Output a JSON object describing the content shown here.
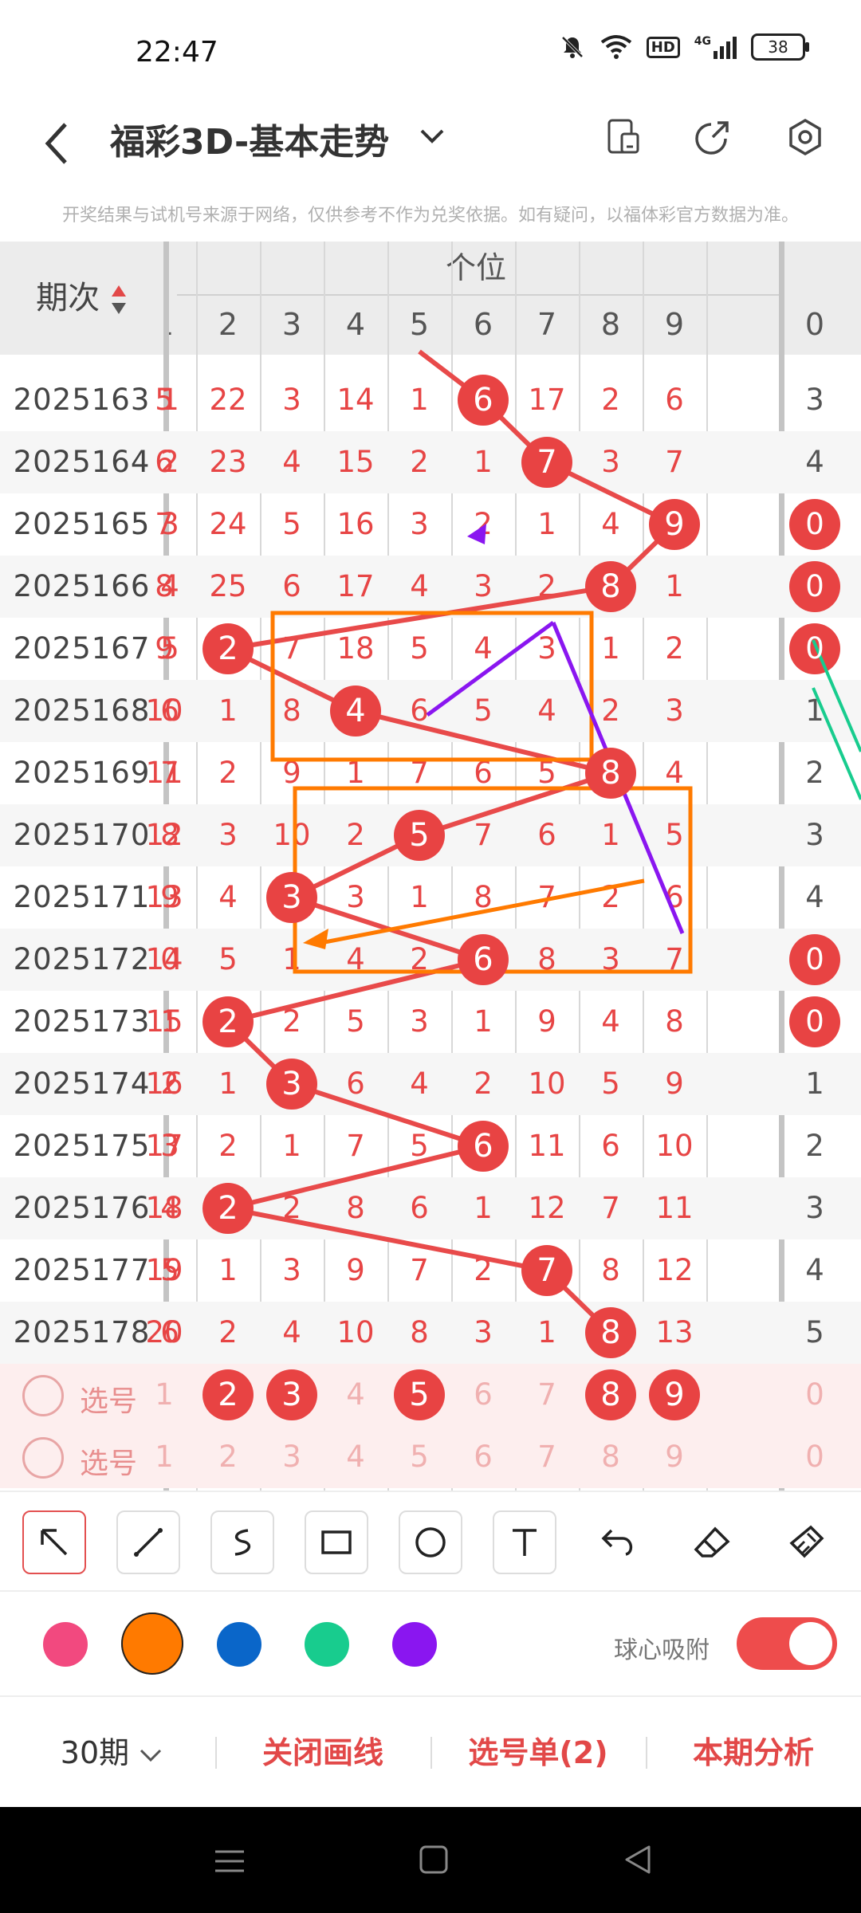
{
  "status": {
    "time": "22:47",
    "network": "4G",
    "hd": "HD",
    "battery": "38"
  },
  "title": {
    "text": "福彩3D-基本走势"
  },
  "notice": "开奖结果与试机号来源于网络，仅供参考不作为兑奖依据。如有疑问，以福体彩官方数据为准。",
  "table": {
    "period_header": "期次",
    "group_header": "个位",
    "digits": [
      "1",
      "2",
      "3",
      "4",
      "5",
      "6",
      "7",
      "8",
      "9"
    ],
    "next_digit": "0",
    "rows": [
      {
        "period": "2025163",
        "left": "1",
        "cells": [
          "5",
          "22",
          "3",
          "14",
          "1",
          "6",
          "17",
          "2",
          "6"
        ],
        "next": "3",
        "ball": "6"
      },
      {
        "period": "2025164",
        "left": "2",
        "cells": [
          "6",
          "23",
          "4",
          "15",
          "2",
          "1",
          "7",
          "3",
          "7"
        ],
        "next": "4",
        "ball": "7"
      },
      {
        "period": "2025165",
        "left": "3",
        "cells": [
          "7",
          "24",
          "5",
          "16",
          "3",
          "2",
          "1",
          "4",
          "9"
        ],
        "next": "0",
        "ball": "9"
      },
      {
        "period": "2025166",
        "left": "4",
        "cells": [
          "8",
          "25",
          "6",
          "17",
          "4",
          "3",
          "2",
          "8",
          "1"
        ],
        "next": "0",
        "ball": "8"
      },
      {
        "period": "2025167",
        "left": "5",
        "cells": [
          "9",
          "2",
          "7",
          "18",
          "5",
          "4",
          "3",
          "1",
          "2"
        ],
        "next": "0",
        "ball": "2"
      },
      {
        "period": "2025168",
        "left": "6",
        "cells": [
          "10",
          "1",
          "8",
          "4",
          "6",
          "5",
          "4",
          "2",
          "3"
        ],
        "next": "1",
        "ball": "4"
      },
      {
        "period": "2025169",
        "left": "7",
        "cells": [
          "11",
          "2",
          "9",
          "1",
          "7",
          "6",
          "5",
          "8",
          "4"
        ],
        "next": "2",
        "ball": "8"
      },
      {
        "period": "2025170",
        "left": "8",
        "cells": [
          "12",
          "3",
          "10",
          "2",
          "5",
          "7",
          "6",
          "1",
          "5"
        ],
        "next": "3",
        "ball": "5"
      },
      {
        "period": "2025171",
        "left": "9",
        "cells": [
          "13",
          "4",
          "3",
          "3",
          "1",
          "8",
          "7",
          "2",
          "6"
        ],
        "next": "4",
        "ball": "3"
      },
      {
        "period": "2025172",
        "left": "0",
        "cells": [
          "14",
          "5",
          "1",
          "4",
          "2",
          "6",
          "8",
          "3",
          "7"
        ],
        "next": "0",
        "ball": "6"
      },
      {
        "period": "2025173",
        "left": "1",
        "cells": [
          "15",
          "2",
          "2",
          "5",
          "3",
          "1",
          "9",
          "4",
          "8"
        ],
        "next": "0",
        "ball": "2"
      },
      {
        "period": "2025174",
        "left": "2",
        "cells": [
          "16",
          "1",
          "3",
          "6",
          "4",
          "2",
          "10",
          "5",
          "9"
        ],
        "next": "1",
        "ball": "3"
      },
      {
        "period": "2025175",
        "left": "3",
        "cells": [
          "17",
          "2",
          "1",
          "7",
          "5",
          "6",
          "11",
          "6",
          "10"
        ],
        "next": "2",
        "ball": "6"
      },
      {
        "period": "2025176",
        "left": "4",
        "cells": [
          "18",
          "2",
          "2",
          "8",
          "6",
          "1",
          "12",
          "7",
          "11"
        ],
        "next": "3",
        "ball": "2"
      },
      {
        "period": "2025177",
        "left": "5",
        "cells": [
          "19",
          "1",
          "3",
          "9",
          "7",
          "2",
          "7",
          "8",
          "12"
        ],
        "next": "4",
        "ball": "7"
      },
      {
        "period": "2025178",
        "left": "6",
        "cells": [
          "20",
          "2",
          "4",
          "10",
          "8",
          "3",
          "1",
          "8",
          "13"
        ],
        "next": "5",
        "ball": "8"
      }
    ],
    "pick_rows": [
      {
        "label": "选号",
        "balls": [
          "2",
          "3",
          "5",
          "8",
          "9"
        ]
      },
      {
        "label": "选号",
        "balls": []
      }
    ]
  },
  "toolbar": {
    "tools": [
      "select-arrow",
      "line",
      "freehand",
      "rectangle",
      "circle",
      "text",
      "undo",
      "eraser",
      "clear"
    ],
    "colors": [
      "#f2497f",
      "#ff7a00",
      "#0a66c9",
      "#18cc8e",
      "#8a16f0"
    ],
    "selected_color": "#ff7a00",
    "snap_label": "球心吸附",
    "snap_on": true
  },
  "actions": {
    "period_select": "30期",
    "close_draw": "关闭画线",
    "pick_list": "选号单(2)",
    "analysis": "本期分析"
  }
}
